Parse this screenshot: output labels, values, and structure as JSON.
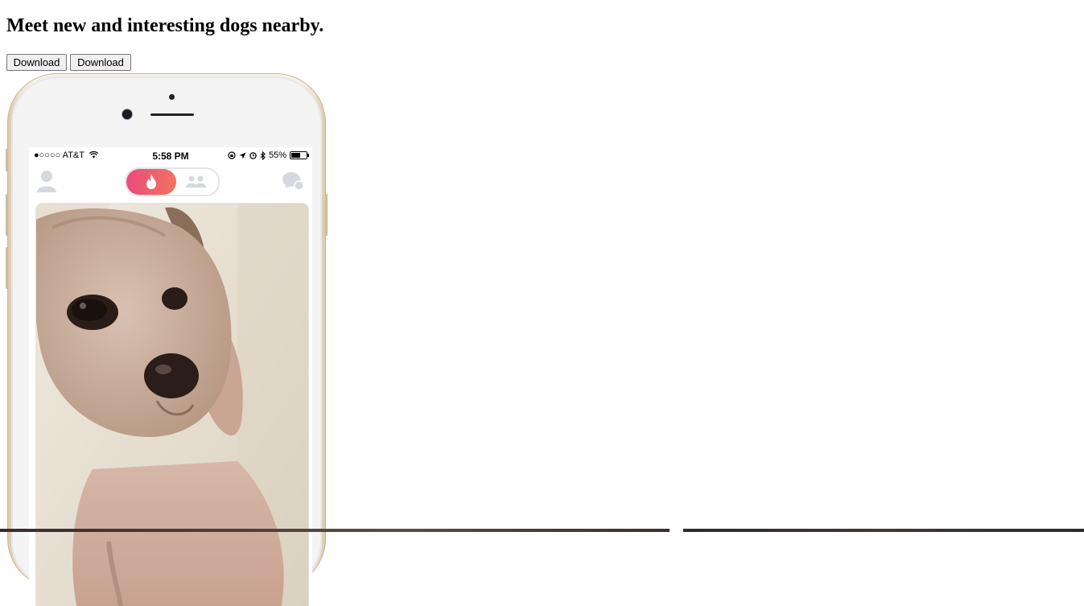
{
  "headline": "Meet new and interesting dogs nearby.",
  "buttons": [
    {
      "label": "Download"
    },
    {
      "label": "Download"
    }
  ],
  "phone": {
    "status_bar": {
      "carrier": "●○○○○ AT&T",
      "time": "5:58 PM",
      "battery": "55%"
    },
    "colors": {
      "toggle_gradient_start": "#ec4b7f",
      "toggle_gradient_end": "#f0735e",
      "inactive_icon": "#d5d8df"
    },
    "icons": {
      "left": "profile-icon",
      "toggle_active": "flame-icon",
      "toggle_inactive": "group-icon",
      "right": "chat-icon"
    }
  }
}
